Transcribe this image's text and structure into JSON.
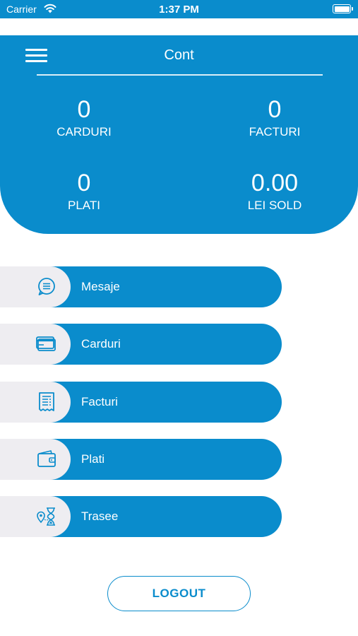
{
  "status_bar": {
    "carrier": "Carrier",
    "time": "1:37 PM"
  },
  "header": {
    "title": "Cont"
  },
  "stats": {
    "cards": {
      "value": "0",
      "label": "CARDURI"
    },
    "invoices": {
      "value": "0",
      "label": "FACTURI"
    },
    "payments": {
      "value": "0",
      "label": "PLATI"
    },
    "balance": {
      "value": "0.00",
      "label": "LEI SOLD"
    }
  },
  "menu": {
    "items": [
      {
        "label": "Mesaje",
        "icon": "chat-icon"
      },
      {
        "label": "Carduri",
        "icon": "credit-card-icon"
      },
      {
        "label": "Facturi",
        "icon": "receipt-icon"
      },
      {
        "label": "Plati",
        "icon": "wallet-icon"
      },
      {
        "label": "Trasee",
        "icon": "route-icon"
      }
    ]
  },
  "logout_label": "LOGOUT",
  "colors": {
    "primary": "#0a8ccc",
    "icon_bg": "#eeedf1",
    "background": "#ffffff"
  }
}
